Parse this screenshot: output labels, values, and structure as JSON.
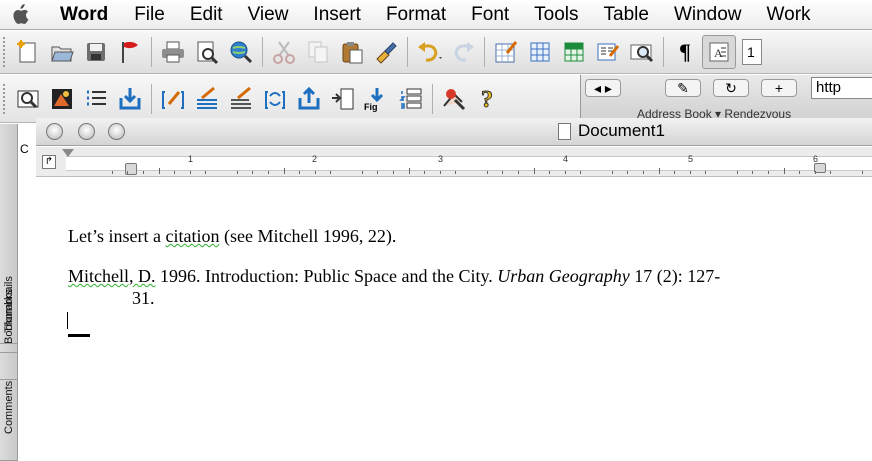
{
  "menubar": {
    "app_name": "Word",
    "items": [
      "File",
      "Edit",
      "View",
      "Insert",
      "Format",
      "Font",
      "Tools",
      "Table",
      "Window",
      "Work"
    ]
  },
  "toolbar_standard": {
    "icons": [
      "new-document-icon",
      "open-icon",
      "save-icon",
      "flag-icon",
      "print-icon",
      "print-preview-icon",
      "web-search-icon",
      "cut-icon",
      "copy-icon",
      "paste-icon",
      "format-painter-icon",
      "undo-icon",
      "redo-icon",
      "tables-borders-icon",
      "insert-table-icon",
      "insert-excel-icon",
      "columns-icon",
      "zoom-icon",
      "show-hide-icon",
      "text-box-icon"
    ],
    "pilcrow": "¶",
    "zoom_partial": "1"
  },
  "toolbar_citation": {
    "icons": [
      "find-reference-icon",
      "insert-figure-icon",
      "format-list-icon",
      "import-icon",
      "insert-citation-icon",
      "edit-citation-icon",
      "edit-citation-2-icon",
      "refresh-icon",
      "export-icon",
      "go-to-icon",
      "insert-figure-list-icon",
      "numbered-list-icon",
      "preferences-icon",
      "help-icon"
    ],
    "fig_label": "Fig"
  },
  "background_window": {
    "url_partial": "http",
    "bookmarks_partial": "Address Book ▾   Rendezvous"
  },
  "sidebar": {
    "tabs": [
      "Bookmarks",
      "Thumbnails",
      "Comments"
    ],
    "letter": "C"
  },
  "document": {
    "title": "Document1",
    "ruler_numbers": [
      "1",
      "2",
      "3",
      "4",
      "5",
      "6"
    ],
    "line1_pre": "Let’s insert a ",
    "line1_squiggle": "citation",
    "line1_post": " (see Mitchell 1996, 22).",
    "ref_squiggle": "Mitchell, D.",
    "ref_pre": " 1996. Introduction: Public Space and the City. ",
    "ref_journal": "Urban Geography",
    "ref_post": " 17 (2): 127-",
    "ref_line2": "31."
  }
}
